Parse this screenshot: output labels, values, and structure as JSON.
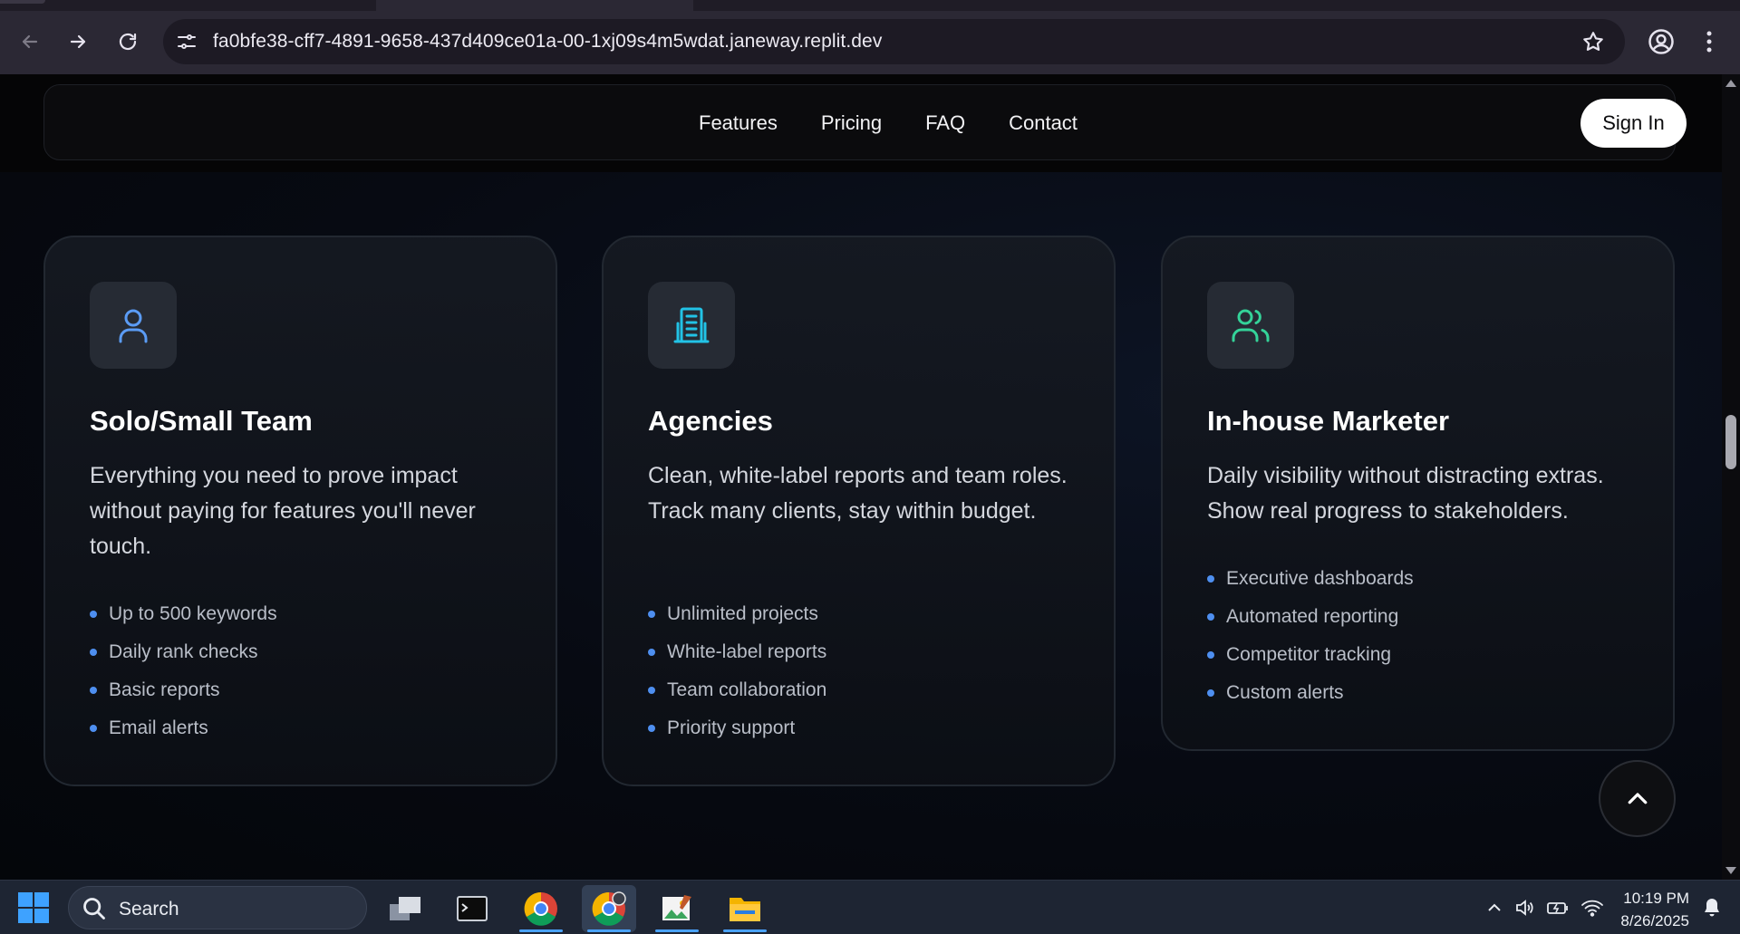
{
  "browser": {
    "url": "fa0bfe38-cff7-4891-9658-437d409ce01a-00-1xj09s4m5wdat.janeway.replit.dev"
  },
  "site_nav": {
    "links": [
      "Features",
      "Pricing",
      "FAQ",
      "Contact"
    ],
    "sign_in": "Sign In"
  },
  "cards": [
    {
      "title": "Solo/Small Team",
      "description": "Everything you need to prove impact without paying for features you'll never touch.",
      "icon": "user-icon",
      "icon_color": "#5b9cf5",
      "features": [
        "Up to 500 keywords",
        "Daily rank checks",
        "Basic reports",
        "Email alerts"
      ]
    },
    {
      "title": "Agencies",
      "description": "Clean, white-label reports and team roles. Track many clients, stay within budget.",
      "icon": "building-icon",
      "icon_color": "#22c3e6",
      "features": [
        "Unlimited projects",
        "White-label reports",
        "Team collaboration",
        "Priority support"
      ]
    },
    {
      "title": "In-house Marketer",
      "description": "Daily visibility without distracting extras. Show real progress to stakeholders.",
      "icon": "users-icon",
      "icon_color": "#34d399",
      "features": [
        "Executive dashboards",
        "Automated reporting",
        "Competitor tracking",
        "Custom alerts"
      ]
    }
  ],
  "taskbar": {
    "search_placeholder": "Search",
    "time": "10:19 PM",
    "date": "8/26/2025"
  }
}
